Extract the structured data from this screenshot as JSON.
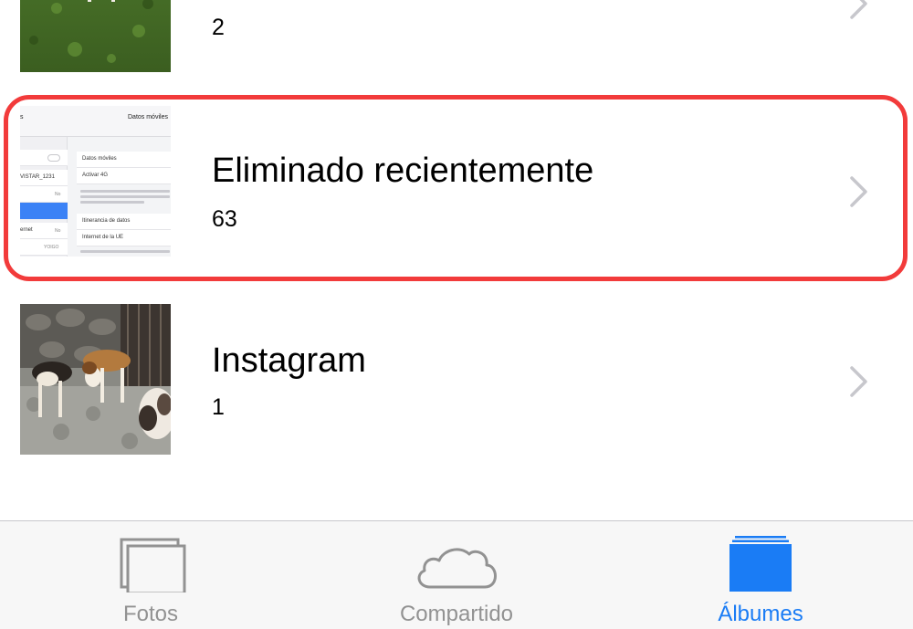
{
  "albums": [
    {
      "title": "",
      "count": "2",
      "thumb": "dog-on-grass-photo"
    },
    {
      "title": "Eliminado recientemente",
      "count": "63",
      "thumb": "settings-screenshot-photo",
      "thumb_text": {
        "header": "Datos móviles",
        "left": [
          "VISTAR_1231",
          "No",
          "ernet",
          "No",
          "YOIGO"
        ],
        "right": [
          "Datos móviles",
          "Activar 4G",
          "Itinerancia de datos",
          "Internet de la UE"
        ]
      }
    },
    {
      "title": "Instagram",
      "count": "1",
      "thumb": "dogs-on-patio-photo"
    }
  ],
  "highlight_color": "#f23b3b",
  "tab_bar": {
    "tabs": [
      {
        "label": "Fotos",
        "icon": "photos-stack-icon",
        "active": false
      },
      {
        "label": "Compartido",
        "icon": "cloud-icon",
        "active": false
      },
      {
        "label": "Álbumes",
        "icon": "albums-folder-icon",
        "active": true
      }
    ],
    "active_color": "#1a7cf5",
    "inactive_color": "#929292"
  }
}
